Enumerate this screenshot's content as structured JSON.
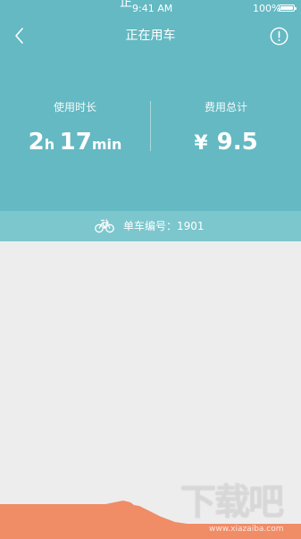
{
  "status_bar": {
    "clipped_char": "正",
    "time": "9:41 AM",
    "battery": "100%"
  },
  "nav": {
    "back_icon": "chevron-left-icon",
    "title": "正在用车",
    "info_icon": "exclamation-circle-icon"
  },
  "stats": {
    "duration": {
      "label": "使用时长",
      "hours": "2",
      "hours_unit": "h",
      "minutes": "17",
      "minutes_unit": "min"
    },
    "cost": {
      "label": "费用总计",
      "currency": "¥",
      "amount": "9.5"
    }
  },
  "bike": {
    "icon": "bicycle-icon",
    "label": "单车编号：1901"
  },
  "watermark": {
    "text": "下载吧",
    "url": "www.xiazaiba.com"
  },
  "colors": {
    "header_bg": "#64b9c3",
    "strip_bg": "#7cc6cd",
    "map_bg": "#ededed",
    "bottom_band": "#f08c66"
  }
}
